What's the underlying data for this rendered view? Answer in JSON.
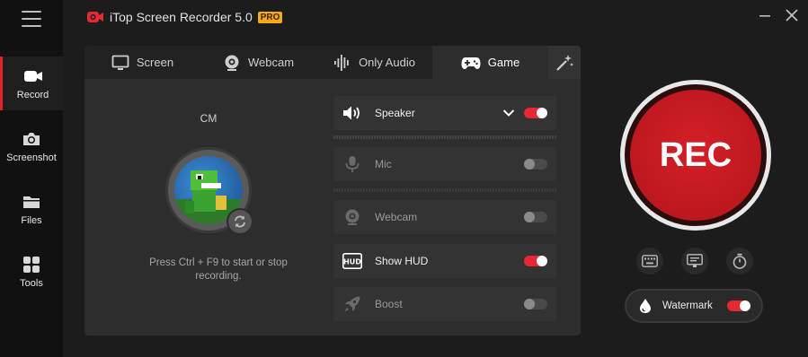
{
  "app": {
    "title": "iTop Screen Recorder 5.0",
    "badge": "PRO"
  },
  "sidebar": {
    "items": [
      {
        "label": "Record",
        "icon": "record-icon",
        "active": true
      },
      {
        "label": "Screenshot",
        "icon": "camera-icon",
        "active": false
      },
      {
        "label": "Files",
        "icon": "folder-icon",
        "active": false
      },
      {
        "label": "Tools",
        "icon": "grid-icon",
        "active": false
      }
    ]
  },
  "tabs": [
    {
      "label": "Screen",
      "icon": "monitor-icon",
      "active": false
    },
    {
      "label": "Webcam",
      "icon": "webcam-icon",
      "active": false
    },
    {
      "label": "Only Audio",
      "icon": "audio-wave-icon",
      "active": false
    },
    {
      "label": "Game",
      "icon": "gamepad-icon",
      "active": true
    }
  ],
  "profile": {
    "name": "CM",
    "hint": "Press Ctrl + F9 to start or stop recording."
  },
  "options": [
    {
      "label": "Speaker",
      "icon": "speaker-icon",
      "enabled": true
    },
    {
      "label": "Mic",
      "icon": "mic-icon",
      "enabled": false
    },
    {
      "label": "Webcam",
      "icon": "webcam-icon",
      "enabled": false
    },
    {
      "label": "Show HUD",
      "icon": "hud-icon",
      "enabled": true
    },
    {
      "label": "Boost",
      "icon": "rocket-icon",
      "enabled": false
    }
  ],
  "rec": {
    "label": "REC"
  },
  "watermark": {
    "label": "Watermark",
    "enabled": true
  },
  "colors": {
    "accent": "#e52832",
    "badge": "#f2a91b"
  }
}
